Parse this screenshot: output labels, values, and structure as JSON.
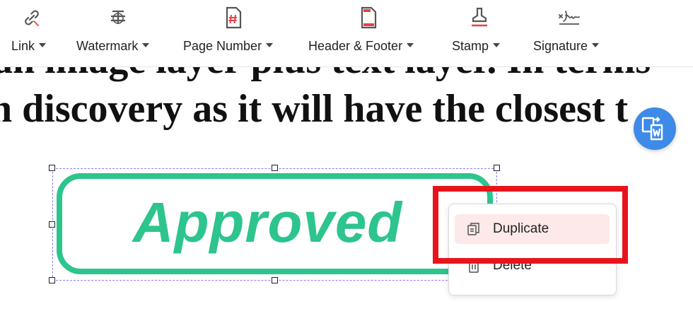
{
  "toolbar": {
    "items": [
      {
        "label": "Link",
        "icon": "link-icon"
      },
      {
        "label": "Watermark",
        "icon": "watermark-icon"
      },
      {
        "label": "Page Number",
        "icon": "page-number-icon"
      },
      {
        "label": "Header & Footer",
        "icon": "header-footer-icon"
      },
      {
        "label": "Stamp",
        "icon": "stamp-icon"
      },
      {
        "label": "Signature",
        "icon": "signature-icon"
      }
    ]
  },
  "document": {
    "line1": "an image layer plus text layer. In terms",
    "line2": "n discovery as it will have the closest t"
  },
  "stamp": {
    "text": "Approved",
    "color": "#2dc48d"
  },
  "context_menu": {
    "items": [
      {
        "label": "Duplicate",
        "icon": "duplicate-icon"
      },
      {
        "label": "Delete",
        "icon": "trash-icon"
      }
    ]
  },
  "fab": {
    "icon": "convert-to-word-icon"
  },
  "colors": {
    "accent": "#3d8ae8",
    "highlight": "#e8141b",
    "stamp": "#2dc48d",
    "menu_hover": "#fde9e9"
  }
}
